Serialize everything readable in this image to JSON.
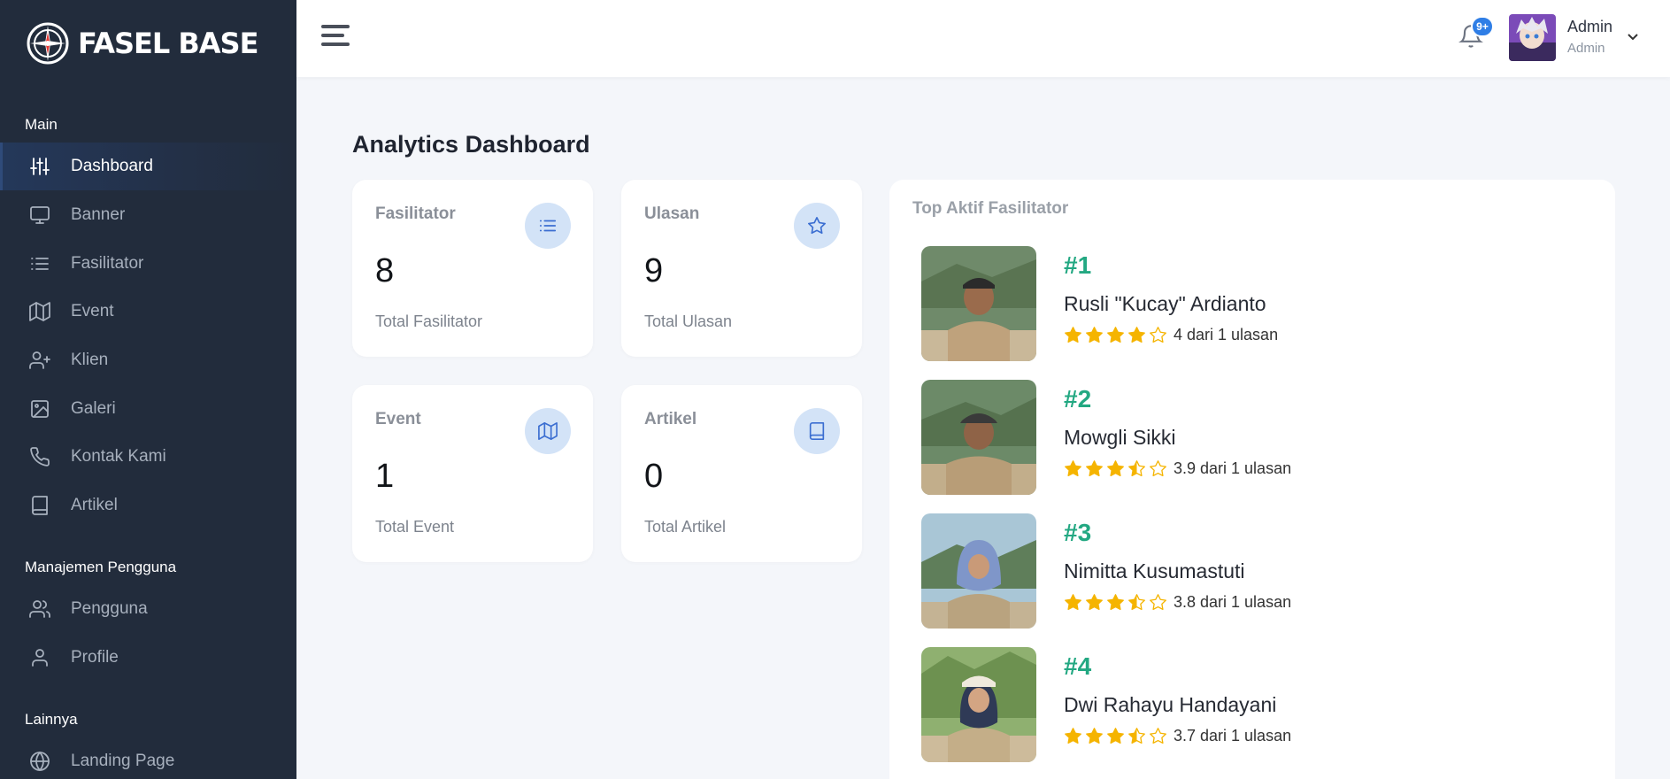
{
  "brand": {
    "name": "FASEL BASE"
  },
  "sidebar": {
    "sections": [
      {
        "label": "Main"
      },
      {
        "label": "Manajemen Pengguna"
      },
      {
        "label": "Lainnya"
      }
    ],
    "items": [
      {
        "label": "Dashboard",
        "icon": "sliders-icon",
        "active": true
      },
      {
        "label": "Banner",
        "icon": "monitor-icon"
      },
      {
        "label": "Fasilitator",
        "icon": "list-icon"
      },
      {
        "label": "Event",
        "icon": "map-icon"
      },
      {
        "label": "Klien",
        "icon": "user-plus-icon"
      },
      {
        "label": "Galeri",
        "icon": "image-icon"
      },
      {
        "label": "Kontak Kami",
        "icon": "phone-icon"
      },
      {
        "label": "Artikel",
        "icon": "book-icon"
      },
      {
        "label": "Pengguna",
        "icon": "users-icon"
      },
      {
        "label": "Profile",
        "icon": "user-icon"
      },
      {
        "label": "Landing Page",
        "icon": "globe-icon"
      }
    ]
  },
  "header": {
    "notification_badge": "9+",
    "user": {
      "name": "Admin",
      "role": "Admin"
    }
  },
  "page": {
    "title_bold": "Analytics",
    "title_rest": "Dashboard"
  },
  "stats": [
    {
      "label": "Fasilitator",
      "value": "8",
      "sub": "Total Fasilitator",
      "icon": "list-icon"
    },
    {
      "label": "Ulasan",
      "value": "9",
      "sub": "Total Ulasan",
      "icon": "star-icon"
    },
    {
      "label": "Event",
      "value": "1",
      "sub": "Total Event",
      "icon": "map-icon"
    },
    {
      "label": "Artikel",
      "value": "0",
      "sub": "Total Artikel",
      "icon": "book-icon"
    }
  ],
  "top_facilitators": {
    "title": "Top Aktif Fasilitator",
    "items": [
      {
        "rank": "#1",
        "name": "Rusli \"Kucay\" Ardianto",
        "rating": 4,
        "rating_text": "4 dari 1 ulasan"
      },
      {
        "rank": "#2",
        "name": "Mowgli Sikki",
        "rating": 3.9,
        "rating_text": "3.9 dari 1 ulasan"
      },
      {
        "rank": "#3",
        "name": "Nimitta Kusumastuti",
        "rating": 3.8,
        "rating_text": "3.8 dari 1 ulasan"
      },
      {
        "rank": "#4",
        "name": "Dwi Rahayu Handayani",
        "rating": 3.7,
        "rating_text": "3.7 dari 1 ulasan"
      }
    ]
  },
  "colors": {
    "sidebar_bg": "#222c3c",
    "accent_green": "#23a882",
    "star": "#f5b400",
    "icon_bg": "#d3e3f7",
    "badge": "#2f7ee6"
  }
}
